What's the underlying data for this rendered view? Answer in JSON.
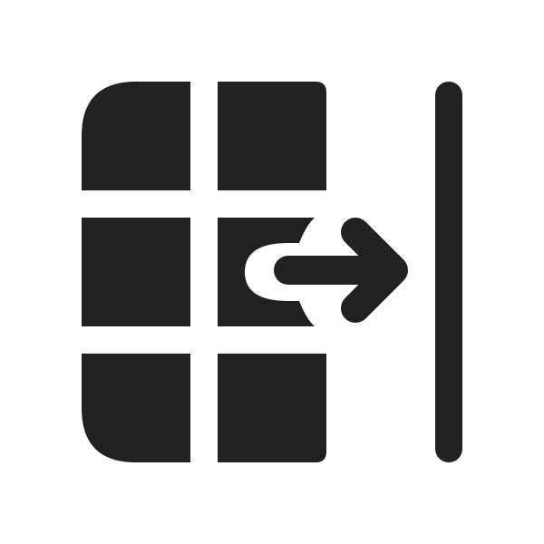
{
  "icon": {
    "name": "table-move-column-right-icon",
    "color": "#212121",
    "background": "#ffffff"
  }
}
